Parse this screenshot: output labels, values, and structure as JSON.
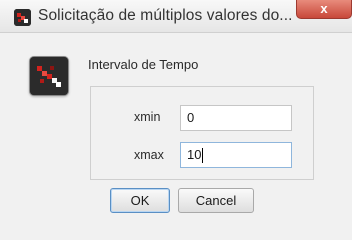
{
  "window": {
    "title": "Solicitação de múltiplos valores do...",
    "close_label": "x",
    "app_icon": "app-logo-icon"
  },
  "dialog": {
    "section_title": "Intervalo de Tempo",
    "fields": [
      {
        "label": "xmin",
        "value": "0"
      },
      {
        "label": "xmax",
        "value": "10"
      }
    ]
  },
  "buttons": {
    "ok_label": "OK",
    "cancel_label": "Cancel"
  },
  "colors": {
    "close_button": "#c8483a",
    "icon_background": "#2b2b2b",
    "icon_accent": "#d3231e",
    "ok_focus_border": "#5a8fc4"
  }
}
